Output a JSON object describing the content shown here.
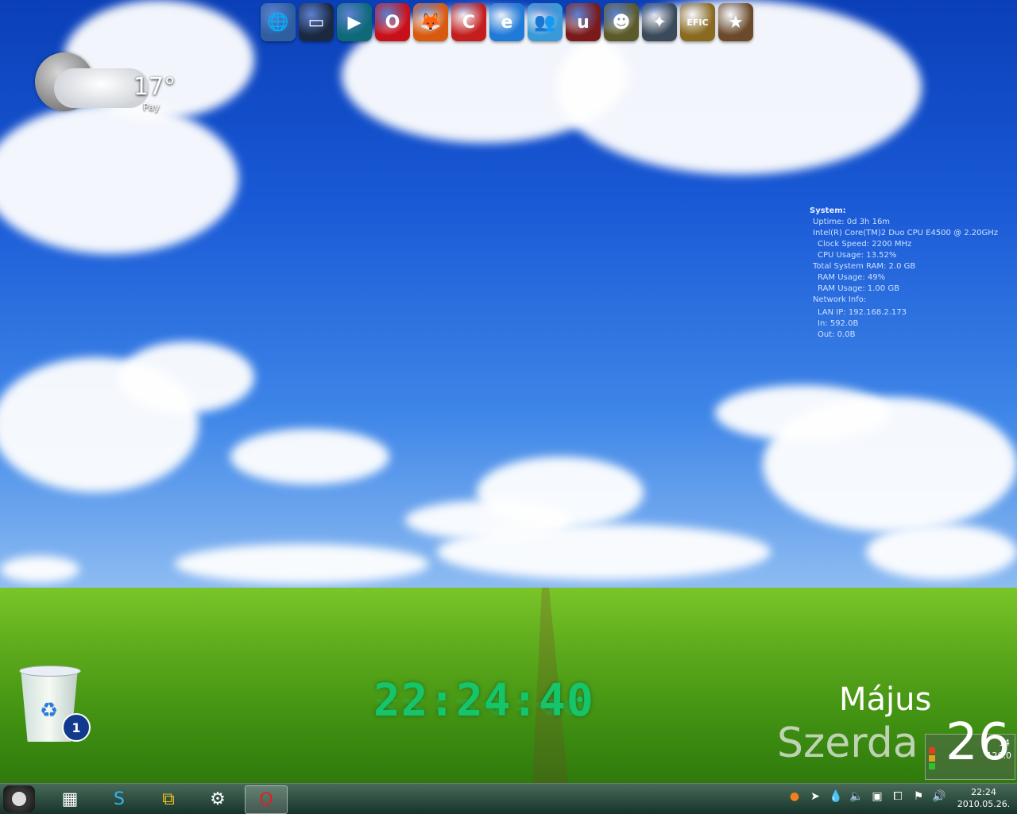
{
  "weather": {
    "temperature": "17°",
    "condition": "Pay"
  },
  "dock": [
    {
      "name": "network",
      "glyph": "🌐",
      "color": "#2f5fa0"
    },
    {
      "name": "media",
      "glyph": "▭",
      "color": "#1b2940"
    },
    {
      "name": "player",
      "glyph": "▶",
      "color": "#0e6a78"
    },
    {
      "name": "opera",
      "glyph": "O",
      "color": "#c8101a"
    },
    {
      "name": "firefox",
      "glyph": "🦊",
      "color": "#d85a10"
    },
    {
      "name": "ccleaner",
      "glyph": "C",
      "color": "#c41e1e"
    },
    {
      "name": "internet-explorer",
      "glyph": "e",
      "color": "#1f7ad8"
    },
    {
      "name": "messenger",
      "glyph": "👥",
      "color": "#3a9ad8"
    },
    {
      "name": "unreal",
      "glyph": "u",
      "color": "#7a1a1a"
    },
    {
      "name": "grenade",
      "glyph": "☻",
      "color": "#5a5a2a"
    },
    {
      "name": "crysis",
      "glyph": "✦",
      "color": "#3a4a5a"
    },
    {
      "name": "efic",
      "glyph": "EFIC",
      "color": "#8a6a20"
    },
    {
      "name": "gta",
      "glyph": "★",
      "color": "#6a4a2a"
    }
  ],
  "sysinfo": {
    "header": "System:",
    "lines": [
      "Uptime:   0d 3h 16m",
      "Intel(R) Core(TM)2 Duo CPU      E4500  @ 2.20GHz",
      "Clock Speed: 2200 MHz",
      "CPU Usage: 13.52%",
      "Total System RAM: 2.0 GB",
      "RAM Usage: 49%",
      "RAM Usage: 1.00 GB",
      "Network Info:",
      "LAN IP:  192.168.2.173",
      "In: 592.0B",
      "Out: 0.0B"
    ]
  },
  "clock": {
    "time": "22:24:40"
  },
  "calendar": {
    "month": "Május",
    "weekday": "Szerda",
    "day": "26"
  },
  "meter": {
    "top": "14",
    "bottom": "126.0"
  },
  "recycle": {
    "badge": "1"
  },
  "taskbar": {
    "buttons": [
      {
        "name": "windows-explorer",
        "glyph": "▦"
      },
      {
        "name": "skype",
        "glyph": "S"
      },
      {
        "name": "vmware",
        "glyph": "⧉"
      },
      {
        "name": "control-panel",
        "glyph": "⚙"
      },
      {
        "name": "opera",
        "glyph": "O"
      }
    ],
    "time": "22:24",
    "date": "2010.05.26."
  }
}
